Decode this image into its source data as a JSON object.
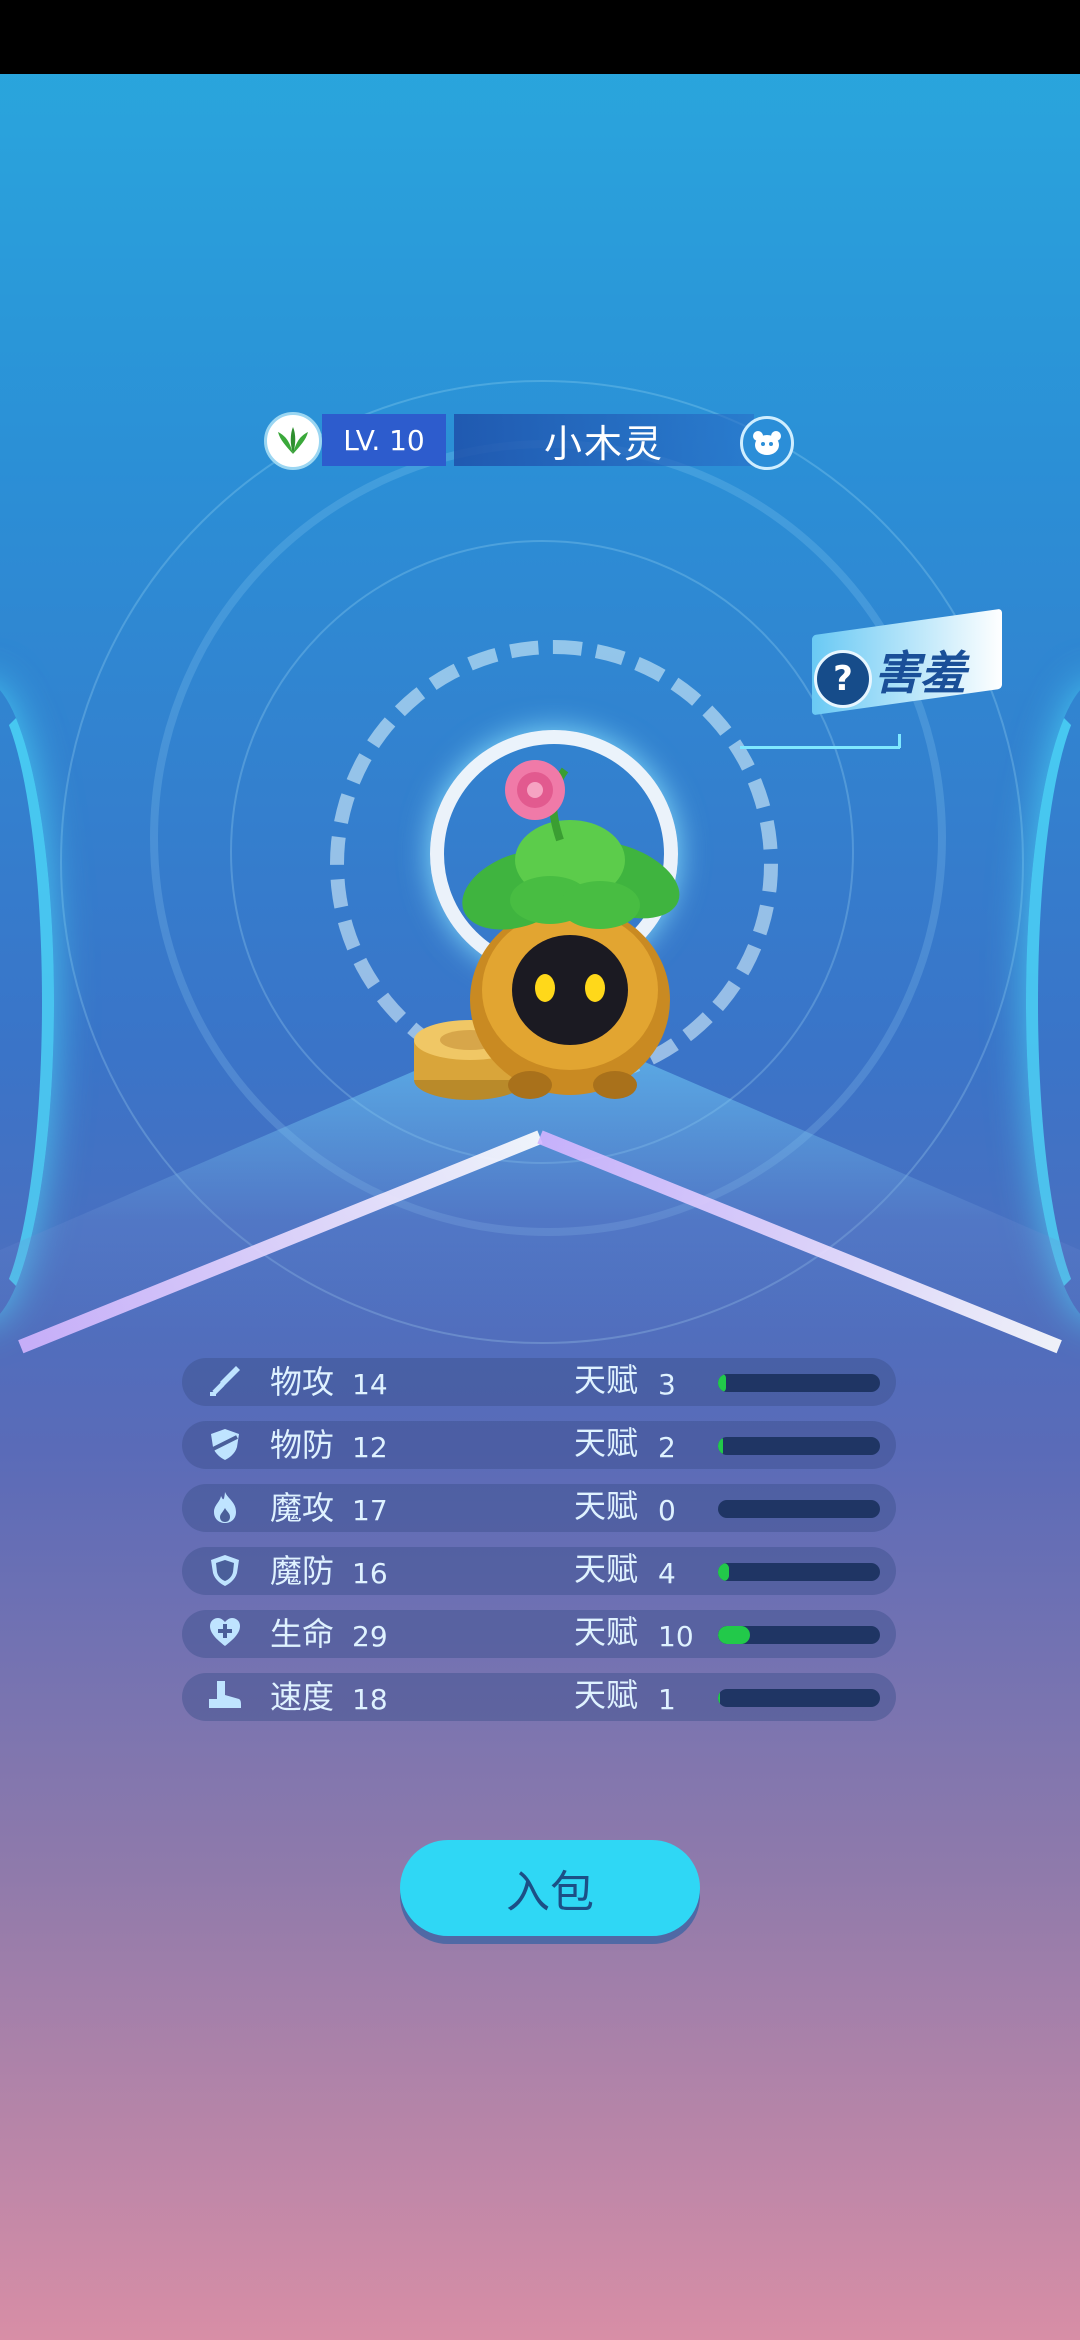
{
  "header": {
    "level": "LV. 10",
    "name": "小木灵",
    "attribute_icon": "leaf-icon",
    "pet_icon": "pet-face-icon"
  },
  "trait": {
    "question_mark": "?",
    "label": "害羞"
  },
  "stats": [
    {
      "icon": "sword-icon",
      "name": "物攻",
      "value": "14",
      "talent_label": "天赋",
      "talent": "3",
      "talent_ratio": 0.05
    },
    {
      "icon": "shield-slash-icon",
      "name": "物防",
      "value": "12",
      "talent_label": "天赋",
      "talent": "2",
      "talent_ratio": 0.03
    },
    {
      "icon": "flame-icon",
      "name": "魔攻",
      "value": "17",
      "talent_label": "天赋",
      "talent": "0",
      "talent_ratio": 0.0
    },
    {
      "icon": "shield-icon",
      "name": "魔防",
      "value": "16",
      "talent_label": "天赋",
      "talent": "4",
      "talent_ratio": 0.07
    },
    {
      "icon": "heart-plus-icon",
      "name": "生命",
      "value": "29",
      "talent_label": "天赋",
      "talent": "10",
      "talent_ratio": 0.2
    },
    {
      "icon": "boot-icon",
      "name": "速度",
      "value": "18",
      "talent_label": "天赋",
      "talent": "1",
      "talent_ratio": 0.01
    }
  ],
  "actions": {
    "bag_button": "入包"
  },
  "colors": {
    "talent_fill": "#22c94a",
    "button": "#2fd7f5"
  }
}
